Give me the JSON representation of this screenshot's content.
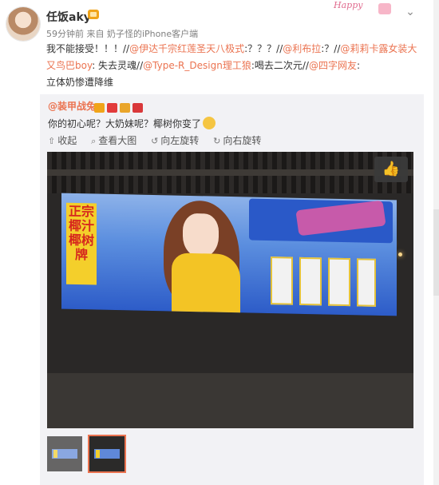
{
  "header": {
    "username": "任饭aky",
    "meta": "59分钟前 来自 奶子怪的iPhone客户端",
    "deco_text": "Happy"
  },
  "post": {
    "p1": "我不能接受！！！//",
    "m1": "@伊达千宗红莲圣天八极式",
    "p2": ":？？？//",
    "m2": "@利布拉",
    "p3": ":？//",
    "m3": "@莉莉卡露女装大又鸟巴boy",
    "p4": ": 失去灵魂//",
    "m4": "@Type-R_Design理工狼",
    "p5": ":喝去二次元//",
    "m5": "@四字网友",
    "p6": ":",
    "p7": "立体奶惨遭降维"
  },
  "repost": {
    "author": "@装甲战兔",
    "text": "你的初心呢？大奶妹呢？椰树你变了"
  },
  "toolbar": {
    "collapse": "收起",
    "view_large": "查看大图",
    "rotate_left": "向左旋转",
    "rotate_right": "向右旋转"
  },
  "photo": {
    "brand_text": "正宗椰汁椰树牌"
  },
  "colors": {
    "link": "#eb7350",
    "repost_bg": "#f2f2f5"
  }
}
